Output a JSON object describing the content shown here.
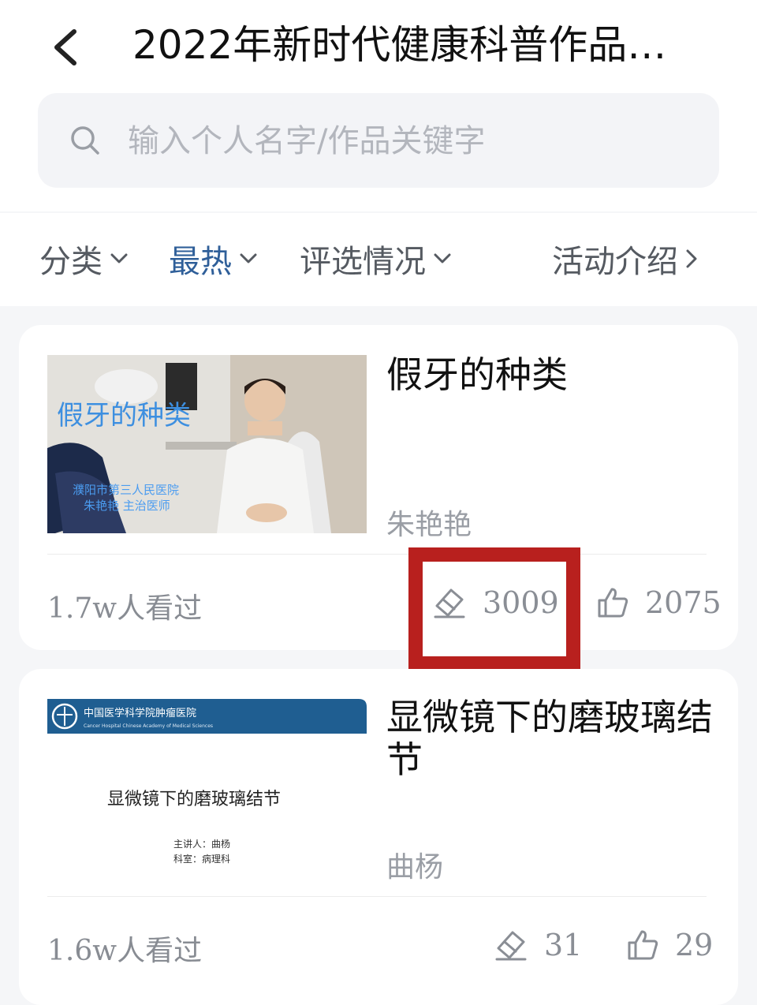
{
  "header": {
    "title": "2022年新时代健康科普作品…",
    "search_placeholder": "输入个人名字/作品关键字"
  },
  "filters": [
    {
      "label": "分类",
      "active": false
    },
    {
      "label": "最热",
      "active": true
    },
    {
      "label": "评选情况",
      "active": false
    },
    {
      "label": "活动介绍",
      "active": false
    }
  ],
  "cards": [
    {
      "title": "假牙的种类",
      "author": "朱艳艳",
      "views": "1.7w人看过",
      "votes": "3009",
      "likes": "2075",
      "thumbnail": {
        "overlay_title": "假牙的种类",
        "hospital": "濮阳市第三人民医院",
        "doctor": "朱艳艳 主治医师"
      }
    },
    {
      "title": "显微镜下的磨玻璃结节",
      "author": "曲杨",
      "views": "1.6w人看过",
      "votes": "31",
      "likes": "29",
      "thumbnail": {
        "institution": "中国医学科学院肿瘤医院",
        "institution_en": "Cancer Hospital Chinese Academy of Medical Sciences",
        "slide_title": "显微镜下的磨玻璃结节",
        "speaker": "主讲人：曲杨",
        "department": "科室：病理科"
      }
    }
  ],
  "colors": {
    "active_filter": "#2f5f99",
    "highlight_box": "#b8201e",
    "slide_banner": "#1f5e91"
  },
  "icons": [
    "back-chevron-icon",
    "search-icon",
    "chevron-down-icon",
    "chevron-right-icon",
    "vote-ticket-icon",
    "thumbs-up-icon"
  ]
}
